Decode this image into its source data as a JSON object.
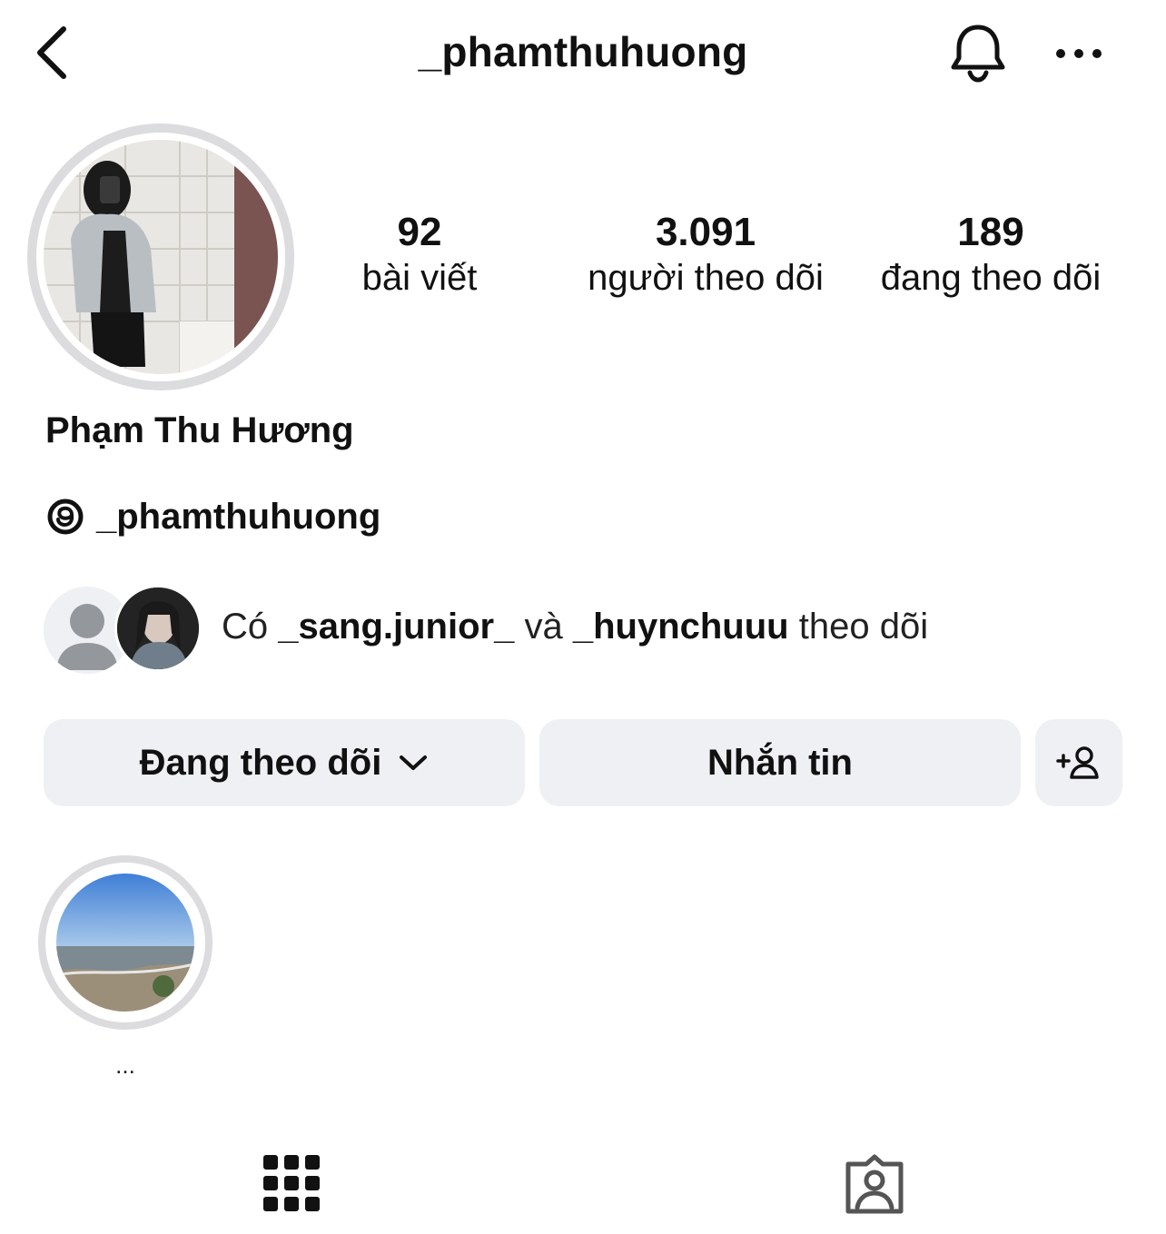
{
  "header": {
    "username": "_phamthuhuong",
    "back_icon": "chevron-left-icon",
    "notification_icon": "bell-icon",
    "more_icon": "ellipsis-icon"
  },
  "profile": {
    "display_name": "Phạm Thu Hương",
    "threads_handle": "_phamthuhuong",
    "stats": {
      "posts": {
        "value": "92",
        "label": "bài viết"
      },
      "followers": {
        "value": "3.091",
        "label": "người theo dõi"
      },
      "following": {
        "value": "189",
        "label": "đang theo dõi"
      }
    },
    "mutual": {
      "prefix": "Có",
      "user1": "_sang.junior_",
      "conj": "và",
      "user2": "_huynchuuu",
      "suffix": "theo dõi"
    }
  },
  "actions": {
    "following_label": "Đang theo dõi",
    "message_label": "Nhắn tin",
    "add_user_icon": "add-person-icon"
  },
  "highlights": [
    {
      "label": "..."
    }
  ],
  "tabs": {
    "grid_icon": "grid-icon",
    "tagged_icon": "tagged-person-icon"
  },
  "colors": {
    "button_bg": "#eff0f3",
    "ring": "#dcdcdf",
    "text": "#111111"
  }
}
